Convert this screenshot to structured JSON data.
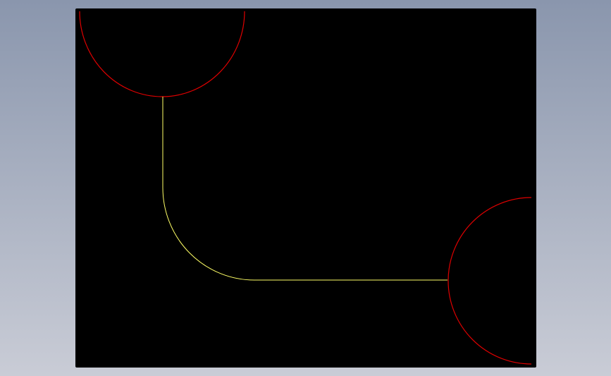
{
  "colors": {
    "background_top": "#8a96ad",
    "background_bottom": "#c9ccd6",
    "canvas": "#000000",
    "arc_stroke": "#e00000",
    "path_stroke": "#ffff66"
  },
  "entities": [
    {
      "kind": "arc",
      "color_name": "red"
    },
    {
      "kind": "arc",
      "color_name": "red"
    },
    {
      "kind": "polyline-with-fillet",
      "color_name": "yellow"
    }
  ]
}
